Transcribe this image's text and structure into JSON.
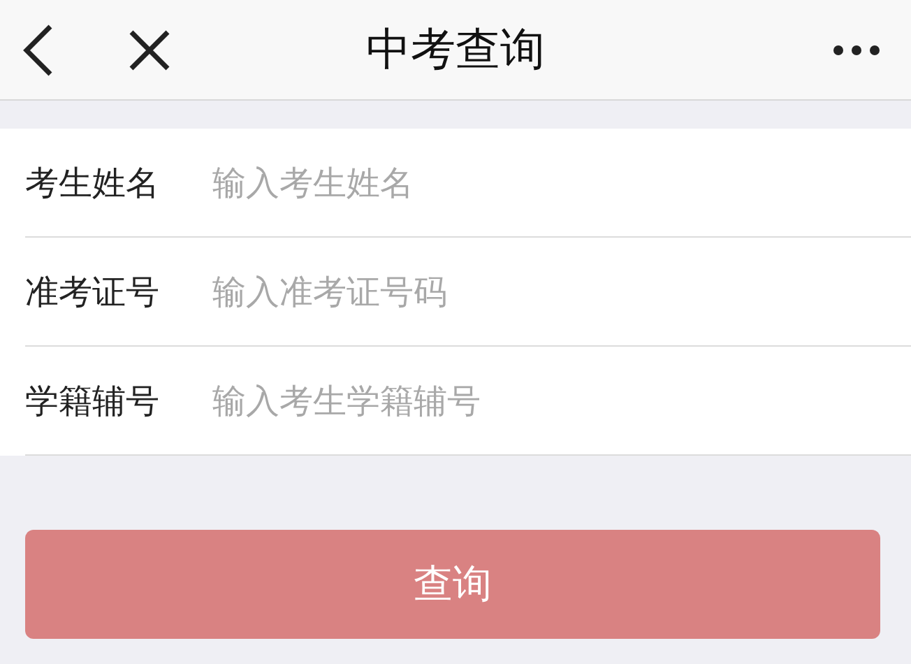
{
  "header": {
    "title": "中考查询"
  },
  "fields": [
    {
      "label": "考生姓名",
      "placeholder": "输入考生姓名"
    },
    {
      "label": "准考证号",
      "placeholder": "输入准考证号码"
    },
    {
      "label": "学籍辅号",
      "placeholder": "输入考生学籍辅号"
    }
  ],
  "submit": {
    "label": "查询"
  }
}
